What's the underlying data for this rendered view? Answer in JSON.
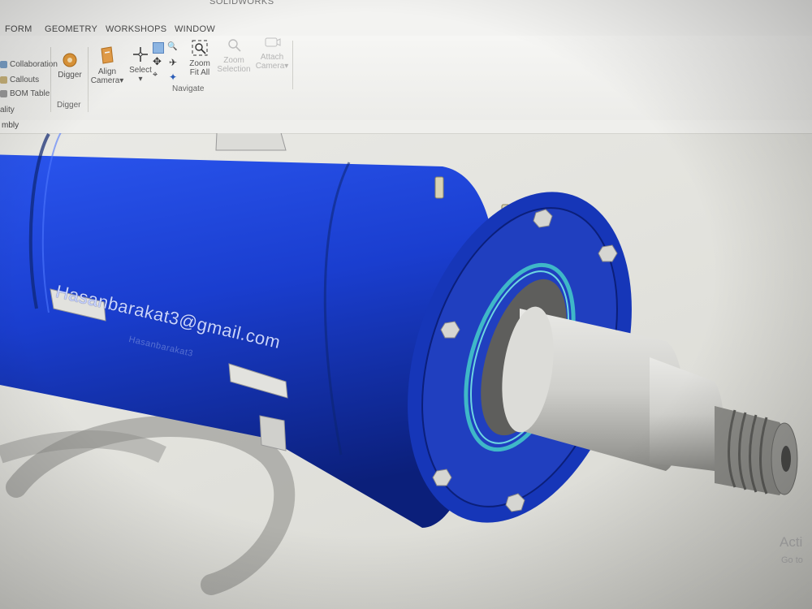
{
  "window": {
    "title": "SOLIDWORKS"
  },
  "menu_tabs": [
    "FORM",
    "GEOMETRY",
    "WORKSHOPS",
    "WINDOW"
  ],
  "ribbon": {
    "left_column": [
      "Collaboration",
      "Callouts",
      "BOM Table",
      "ality"
    ],
    "digger": {
      "button_label": "Digger",
      "group_label": "Digger"
    },
    "align_camera": {
      "label_line1": "Align",
      "label_line2": "Camera"
    },
    "select": {
      "label": "Select"
    },
    "zoom_fit_all": {
      "label_line1": "Zoom",
      "label_line2": "Fit All"
    },
    "zoom_selection": {
      "label_line1": "Zoom",
      "label_line2": "Selection"
    },
    "attach_camera": {
      "label_line1": "Attach",
      "label_line2": "Camera"
    },
    "navigate_group_label": "Navigate"
  },
  "panel": {
    "label": "mbly"
  },
  "model": {
    "engraved_name": "Hasanbarakat3",
    "email": "Hasanbarakat3@gmail.com",
    "body_color": "#1a3ecf",
    "metal_color": "#c9c9c6",
    "seal_color": "#3fb8c8"
  },
  "watermark": {
    "line1": "Acti",
    "line2": "Go to"
  }
}
